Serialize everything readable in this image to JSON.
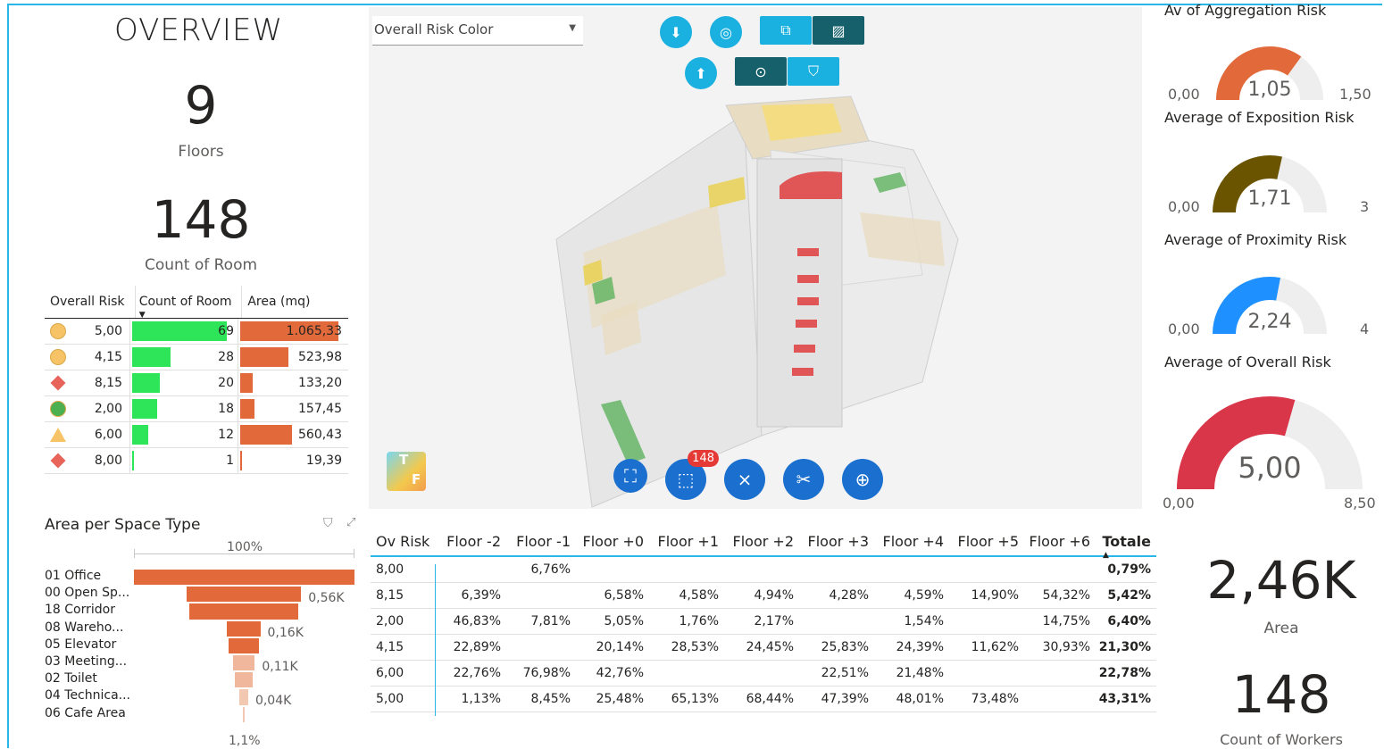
{
  "overview": {
    "title": "OVERVIEW",
    "floors_value": "9",
    "floors_label": "Floors",
    "rooms_value": "148",
    "rooms_label": "Count of Room"
  },
  "risk_table": {
    "headers": [
      "Overall Risk",
      "Count of Room",
      "Area (mq)"
    ],
    "rows": [
      {
        "shape": "circle",
        "color": "#f6c366",
        "risk": "5,00",
        "count": "69",
        "count_frac": 1.0,
        "area": "1.065,33",
        "area_frac": 1.0
      },
      {
        "shape": "circle",
        "color": "#f6c366",
        "risk": "4,15",
        "count": "28",
        "count_frac": 0.406,
        "area": "523,98",
        "area_frac": 0.492
      },
      {
        "shape": "diamond",
        "color": "#e8635a",
        "risk": "8,15",
        "count": "20",
        "count_frac": 0.29,
        "area": "133,20",
        "area_frac": 0.125
      },
      {
        "shape": "circle",
        "color": "#4caf50",
        "risk": "2,00",
        "count": "18",
        "count_frac": 0.261,
        "area": "157,45",
        "area_frac": 0.148
      },
      {
        "shape": "triangle",
        "color": "#f6c366",
        "risk": "6,00",
        "count": "12",
        "count_frac": 0.174,
        "area": "560,43",
        "area_frac": 0.526
      },
      {
        "shape": "diamond",
        "color": "#e8635a",
        "risk": "8,00",
        "count": "1",
        "count_frac": 0.014,
        "area": "19,39",
        "area_frac": 0.018
      }
    ]
  },
  "funnel": {
    "title": "Area per Space Type",
    "top_label": "100%",
    "bottom_label": "1,1%",
    "items": [
      {
        "label": "01 Office",
        "frac": 1.0,
        "value_label": ""
      },
      {
        "label": "00 Open Sp...",
        "frac": 0.52,
        "value_label": "0,56K"
      },
      {
        "label": "18 Corridor",
        "frac": 0.49,
        "value_label": ""
      },
      {
        "label": "08 Wareho...",
        "frac": 0.15,
        "value_label": "0,16K"
      },
      {
        "label": "05 Elevator",
        "frac": 0.14,
        "value_label": ""
      },
      {
        "label": "03 Meeting...",
        "frac": 0.1,
        "value_label": "0,11K"
      },
      {
        "label": "02 Toilet",
        "frac": 0.08,
        "value_label": ""
      },
      {
        "label": "04 Technica...",
        "frac": 0.04,
        "value_label": "0,04K"
      },
      {
        "label": "06 Cafe Area",
        "frac": 0.011,
        "value_label": ""
      }
    ]
  },
  "viewer": {
    "dropdown_value": "Overall Risk Color",
    "selection_badge": "148",
    "cube_faces": [
      "T",
      "F"
    ]
  },
  "floor_table": {
    "headers": [
      "Ov Risk",
      "Floor -2",
      "Floor -1",
      "Floor +0",
      "Floor +1",
      "Floor +2",
      "Floor +3",
      "Floor +4",
      "Floor +5",
      "Floor +6",
      "Totale"
    ],
    "rows": [
      [
        "8,00",
        "",
        "6,76%",
        "",
        "",
        "",
        "",
        "",
        "",
        "",
        "0,79%"
      ],
      [
        "8,15",
        "6,39%",
        "",
        "6,58%",
        "4,58%",
        "4,94%",
        "4,28%",
        "4,59%",
        "14,90%",
        "54,32%",
        "5,42%"
      ],
      [
        "2,00",
        "46,83%",
        "7,81%",
        "5,05%",
        "1,76%",
        "2,17%",
        "",
        "1,54%",
        "",
        "14,75%",
        "6,40%"
      ],
      [
        "4,15",
        "22,89%",
        "",
        "20,14%",
        "28,53%",
        "24,45%",
        "25,83%",
        "24,39%",
        "11,62%",
        "30,93%",
        "21,30%"
      ],
      [
        "6,00",
        "22,76%",
        "76,98%",
        "42,76%",
        "",
        "",
        "22,51%",
        "21,48%",
        "",
        "",
        "22,78%"
      ],
      [
        "5,00",
        "1,13%",
        "8,45%",
        "25,48%",
        "65,13%",
        "68,44%",
        "47,39%",
        "48,01%",
        "73,48%",
        "",
        "43,31%"
      ]
    ]
  },
  "gauges": [
    {
      "title": "Av of Aggregation Risk",
      "min": "0,00",
      "max": "1,50",
      "value": "1,05",
      "frac": 0.7,
      "color": "#e2693a"
    },
    {
      "title": "Average of Exposition Risk",
      "min": "0,00",
      "max": "3",
      "value": "1,71",
      "frac": 0.57,
      "color": "#6b5400"
    },
    {
      "title": "Average of Proximity Risk",
      "min": "0,00",
      "max": "4",
      "value": "2,24",
      "frac": 0.56,
      "color": "#1e90ff"
    },
    {
      "title": "Average of Overall Risk",
      "min": "0,00",
      "max": "8,50",
      "value": "5,00",
      "frac": 0.588,
      "color": "#d9364a"
    }
  ],
  "right_kpis": {
    "area_value": "2,46K",
    "area_label": "Area",
    "workers_value": "148",
    "workers_label": "Count of Workers"
  }
}
